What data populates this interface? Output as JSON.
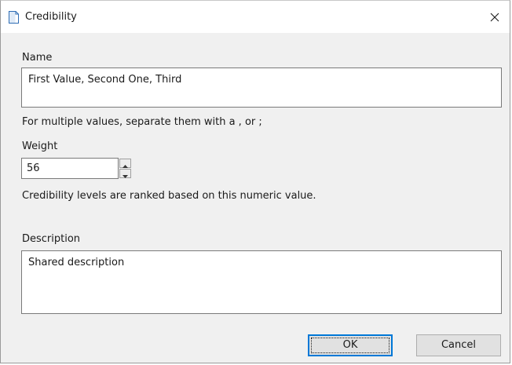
{
  "window": {
    "title": "Credibility",
    "icon": "document-icon",
    "close_glyph": "✕"
  },
  "form": {
    "name_label": "Name",
    "name_value": "First Value, Second One, Third",
    "name_hint": "For multiple values, separate them with a , or ;",
    "weight_label": "Weight",
    "weight_value": "56",
    "weight_hint": "Credibility levels are ranked based on this numeric value.",
    "description_label": "Description",
    "description_value": "Shared description"
  },
  "buttons": {
    "ok_label": "OK",
    "cancel_label": "Cancel"
  },
  "colors": {
    "dialog_background": "#f0f0f0",
    "titlebar_background": "#ffffff",
    "default_button_border": "#0078d7"
  }
}
